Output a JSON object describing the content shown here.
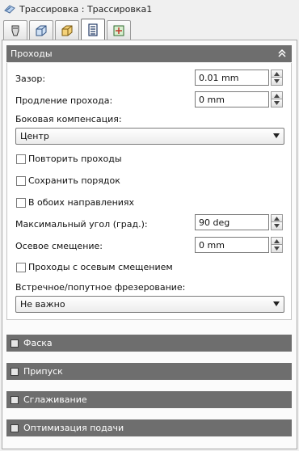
{
  "window": {
    "title": "Трассировка : Трассировка1",
    "icon": "toolpath-icon"
  },
  "tabs": [
    {
      "icon": "tool-icon"
    },
    {
      "icon": "stock-box-icon"
    },
    {
      "icon": "workpiece-icon"
    },
    {
      "icon": "passes-icon",
      "active": true
    },
    {
      "icon": "linking-icon"
    }
  ],
  "passes": {
    "title": "Проходы",
    "gap_label": "Зазор:",
    "gap_value": "0.01 mm",
    "extension_label": "Продление прохода:",
    "extension_value": "0 mm",
    "compensation_label": "Боковая компенсация:",
    "compensation_value": "Центр",
    "repeat_passes": {
      "label": "Повторить проходы",
      "checked": false
    },
    "keep_order": {
      "label": "Сохранить порядок",
      "checked": false
    },
    "both_directions": {
      "label": "В обоих направлениях",
      "checked": false
    },
    "max_angle_label": "Максимальный угол (град.):",
    "max_angle_value": "90 deg",
    "axial_offset_label": "Осевое смещение:",
    "axial_offset_value": "0 mm",
    "axial_offset_passes": {
      "label": "Проходы с осевым смещением",
      "checked": false
    },
    "milling_label": "Встречное/попутное фрезерование:",
    "milling_value": "Не важно"
  },
  "sections": {
    "chamfer": "Фаска",
    "allowance": "Припуск",
    "smoothing": "Сглаживание",
    "feed_optimization": "Оптимизация подачи"
  },
  "colors": {
    "section_header": "#6e6e6e",
    "section_text": "#ffffff",
    "background": "#f0f0f0"
  }
}
